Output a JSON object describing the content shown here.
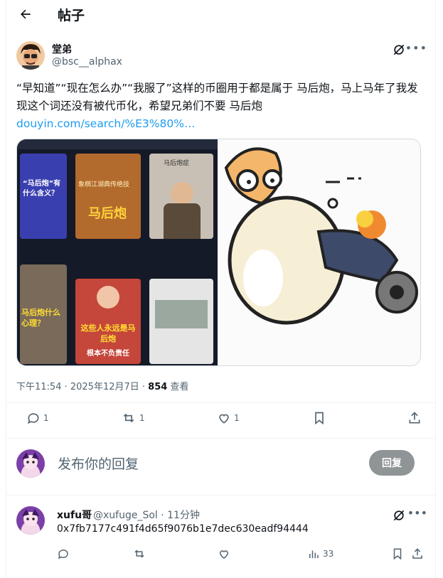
{
  "header": {
    "title": "帖子"
  },
  "post": {
    "author_name": "堂弟",
    "author_handle": "@bsc__alphax",
    "text": "“早知道”“现在怎么办”“我服了”这样的币圈用于都是属于 马后炮，马上马年了我发现这个词还没有被代币化，希望兄弟们不要 马后炮",
    "link": "douyin.com/search/%E3%80%…",
    "media_left": {
      "tile1_title": "“马后炮”有什么含义？",
      "tile2_title": "马后炮",
      "tile2_subtitle": "象棋江湖典传绝技",
      "tile3_caption": "马后炮症",
      "tile4_title": "马后炮什么心理？",
      "tile5_title": "这些人永远是马后炮",
      "tile5_subtitle": "根本不负责任"
    },
    "timestamp": "下午11:54 · 2025年12月7日 · ",
    "views_count": "854",
    "views_label": " 查看",
    "replies": "1",
    "reposts": "1",
    "likes": "1"
  },
  "reply_composer": {
    "placeholder": "发布你的回复",
    "button": "回复"
  },
  "comment": {
    "name": "xufu哥",
    "handle": "@xufuge_Sol · 11分钟",
    "text": "0x7fb7177c491f4d65f9076b1e7dec630eadf94444",
    "views": "33"
  },
  "colors": {
    "accent": "#1d9bf0",
    "muted": "#536471",
    "border": "#eff3f4"
  }
}
